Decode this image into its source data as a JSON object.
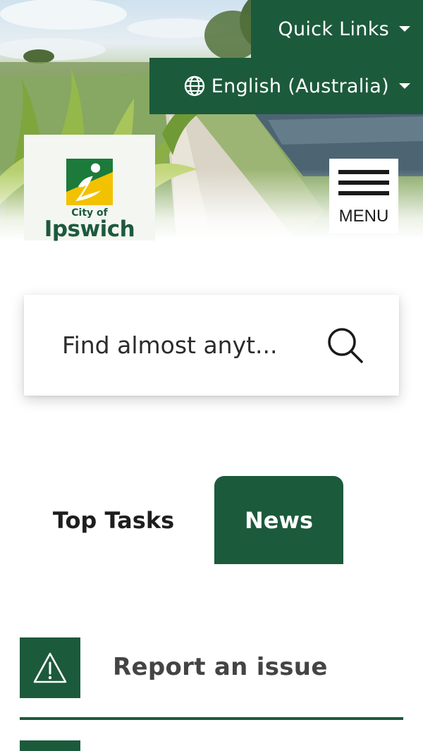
{
  "header": {
    "quick_links_label": "Quick Links",
    "language_label": "English (Australia)",
    "logo_small": "City of",
    "logo_name": "Ipswich",
    "menu_label": "MENU"
  },
  "search": {
    "placeholder": "Find almost anyt..."
  },
  "tabs": [
    {
      "label": "Top Tasks",
      "active": false
    },
    {
      "label": "News",
      "active": true
    }
  ],
  "tasks": [
    {
      "label": "Report an issue",
      "icon": "warning-icon"
    }
  ],
  "colors": {
    "brand_green": "#1c5a3c",
    "logo_yellow": "#f2c200",
    "logo_green": "#1c7a3a"
  }
}
